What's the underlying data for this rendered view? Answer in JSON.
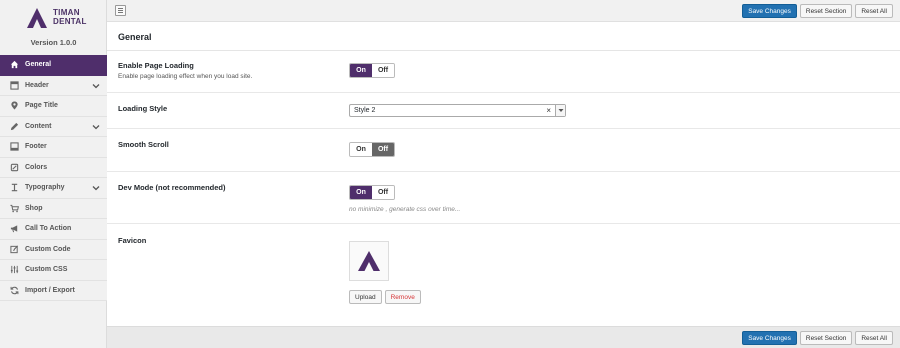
{
  "brand": {
    "line1": "TIMAN",
    "line2": "DENTAL",
    "version": "Version 1.0.0",
    "color": "#4f2e6b"
  },
  "sidebar": {
    "items": [
      {
        "label": "General",
        "icon": "home-icon",
        "active": true,
        "has_chevron": false
      },
      {
        "label": "Header",
        "icon": "header-icon",
        "active": false,
        "has_chevron": true
      },
      {
        "label": "Page Title",
        "icon": "map-pin-icon",
        "active": false,
        "has_chevron": false
      },
      {
        "label": "Content",
        "icon": "pencil-icon",
        "active": false,
        "has_chevron": true
      },
      {
        "label": "Footer",
        "icon": "footer-icon",
        "active": false,
        "has_chevron": false
      },
      {
        "label": "Colors",
        "icon": "color-picker-icon",
        "active": false,
        "has_chevron": false
      },
      {
        "label": "Typography",
        "icon": "typography-icon",
        "active": false,
        "has_chevron": true
      },
      {
        "label": "Shop",
        "icon": "cart-icon",
        "active": false,
        "has_chevron": false
      },
      {
        "label": "Call To Action",
        "icon": "megaphone-icon",
        "active": false,
        "has_chevron": false
      },
      {
        "label": "Custom Code",
        "icon": "code-edit-icon",
        "active": false,
        "has_chevron": false
      },
      {
        "label": "Custom CSS",
        "icon": "sliders-icon",
        "active": false,
        "has_chevron": false
      },
      {
        "label": "Import / Export",
        "icon": "refresh-icon",
        "active": false,
        "has_chevron": false
      }
    ]
  },
  "toolbar": {
    "save_label": "Save Changes",
    "reset_section_label": "Reset Section",
    "reset_all_label": "Reset All"
  },
  "main": {
    "section_title": "General",
    "page_loading": {
      "label": "Enable Page Loading",
      "description": "Enable page loading effect when you load site.",
      "on_label": "On",
      "off_label": "Off",
      "value": "On"
    },
    "loading_style": {
      "label": "Loading Style",
      "value": "Style 2",
      "clear": "×"
    },
    "smooth_scroll": {
      "label": "Smooth Scroll",
      "on_label": "On",
      "off_label": "Off",
      "value": "Off"
    },
    "dev_mode": {
      "label": "Dev Mode (not recommended)",
      "on_label": "On",
      "off_label": "Off",
      "value": "On",
      "hint": "no minimize , generate css over time..."
    },
    "favicon": {
      "label": "Favicon",
      "upload_label": "Upload",
      "remove_label": "Remove"
    }
  }
}
